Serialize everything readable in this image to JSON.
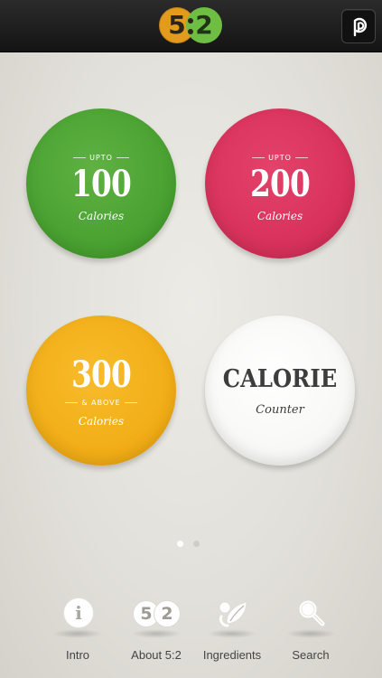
{
  "header": {
    "logo_left": "5",
    "logo_right": "2",
    "logo_icon": "pinterest-p-icon"
  },
  "tiles": [
    {
      "prefix": "UPTO",
      "value": "100",
      "sub": "Calories",
      "color": "#47a02f"
    },
    {
      "prefix": "UPTO",
      "value": "200",
      "sub": "Calories",
      "color": "#d6305a"
    },
    {
      "value": "300",
      "suffix": "& ABOVE",
      "sub": "Calories",
      "color": "#f1ac15"
    },
    {
      "value": "CALORIE",
      "sub": "Counter",
      "color": "#f7f7f5"
    }
  ],
  "pager": {
    "total": 2,
    "active": 1
  },
  "nav": [
    {
      "label": "Intro",
      "icon": "info-icon"
    },
    {
      "label": "About 5:2",
      "icon": "five-two-logo-icon"
    },
    {
      "label": "Ingredients",
      "icon": "leaf-icon"
    },
    {
      "label": "Search",
      "icon": "magnifier-icon"
    }
  ],
  "colors": {
    "topbar": "#1d1d1d",
    "background": "#e2e0da",
    "nav_label": "#444444"
  }
}
